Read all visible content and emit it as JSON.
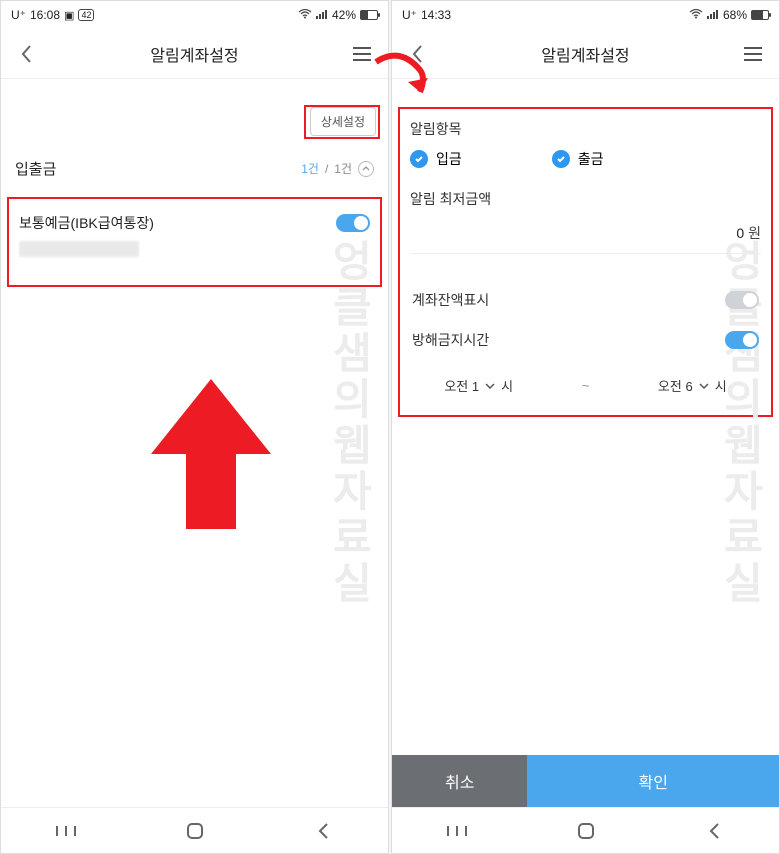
{
  "watermark": "엉클샘의웹자료실",
  "left": {
    "status": {
      "carrier": "U⁺",
      "time": "16:08",
      "battery_pct": "42%",
      "battery_fill": 42
    },
    "header": {
      "title": "알림계좌설정"
    },
    "detail_btn": "상세설정",
    "section": {
      "title": "입출금",
      "count_current": "1건",
      "count_sep": "/",
      "count_total": "1건"
    },
    "account": {
      "name": "보통예금(IBK급여통장)"
    }
  },
  "right": {
    "status": {
      "carrier": "U⁺",
      "time": "14:33",
      "battery_pct": "68%",
      "battery_fill": 68
    },
    "header": {
      "title": "알림계좌설정"
    },
    "labels": {
      "category": "알림항목",
      "deposit": "입금",
      "withdraw": "출금",
      "min_amount": "알림 최저금액",
      "amount_value": "0",
      "won": "원",
      "show_balance": "계좌잔액표시",
      "dnd": "방해금지시간",
      "am1": "오전 1",
      "am6": "오전 6",
      "hour": "시",
      "tilde": "~"
    },
    "footer": {
      "cancel": "취소",
      "confirm": "확인"
    }
  }
}
